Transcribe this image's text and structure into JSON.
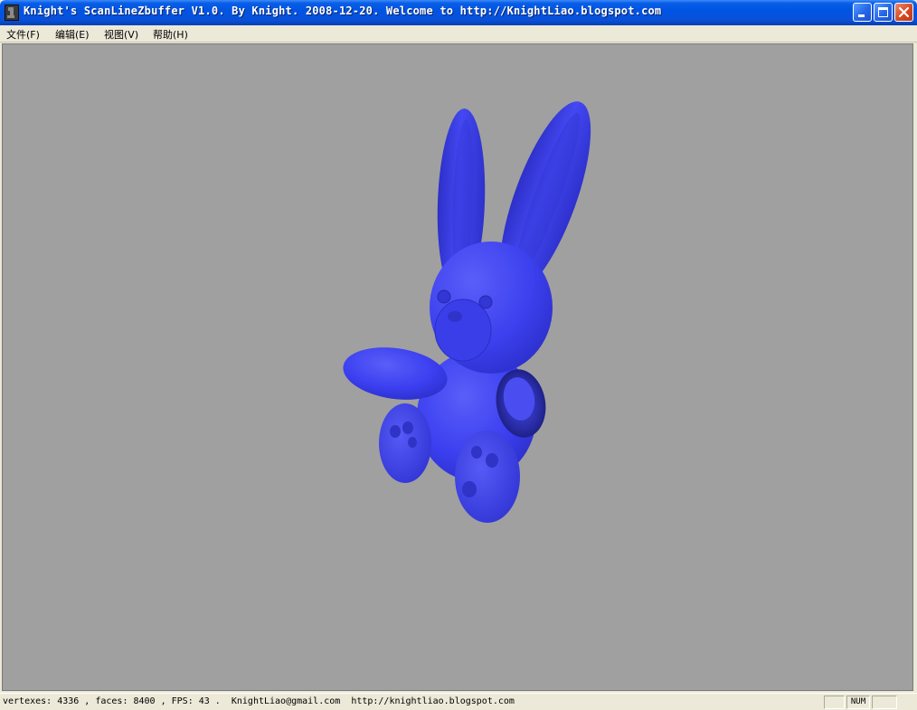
{
  "window": {
    "title": "Knight's ScanLineZbuffer V1.0. By Knight. 2008-12-20.  Welcome to http://KnightLiao.blogspot.com",
    "app_icon": "knight-chess-icon",
    "controls": {
      "minimize_icon": "minimize-icon",
      "maximize_icon": "maximize-icon",
      "close_icon": "close-icon"
    }
  },
  "menu": {
    "items": [
      {
        "label": "文件(F)"
      },
      {
        "label": "编辑(E)"
      },
      {
        "label": "视图(V)"
      },
      {
        "label": "帮助(H)"
      }
    ]
  },
  "viewport": {
    "background_color": "#a0a0a0",
    "model_color": "#3b3ff0",
    "model": "bunny"
  },
  "status": {
    "text": "vertexes: 4336 , faces: 8400 , FPS: 43 .  KnightLiao@gmail.com  http://knightliao.blogspot.com",
    "pane_num": "NUM"
  }
}
